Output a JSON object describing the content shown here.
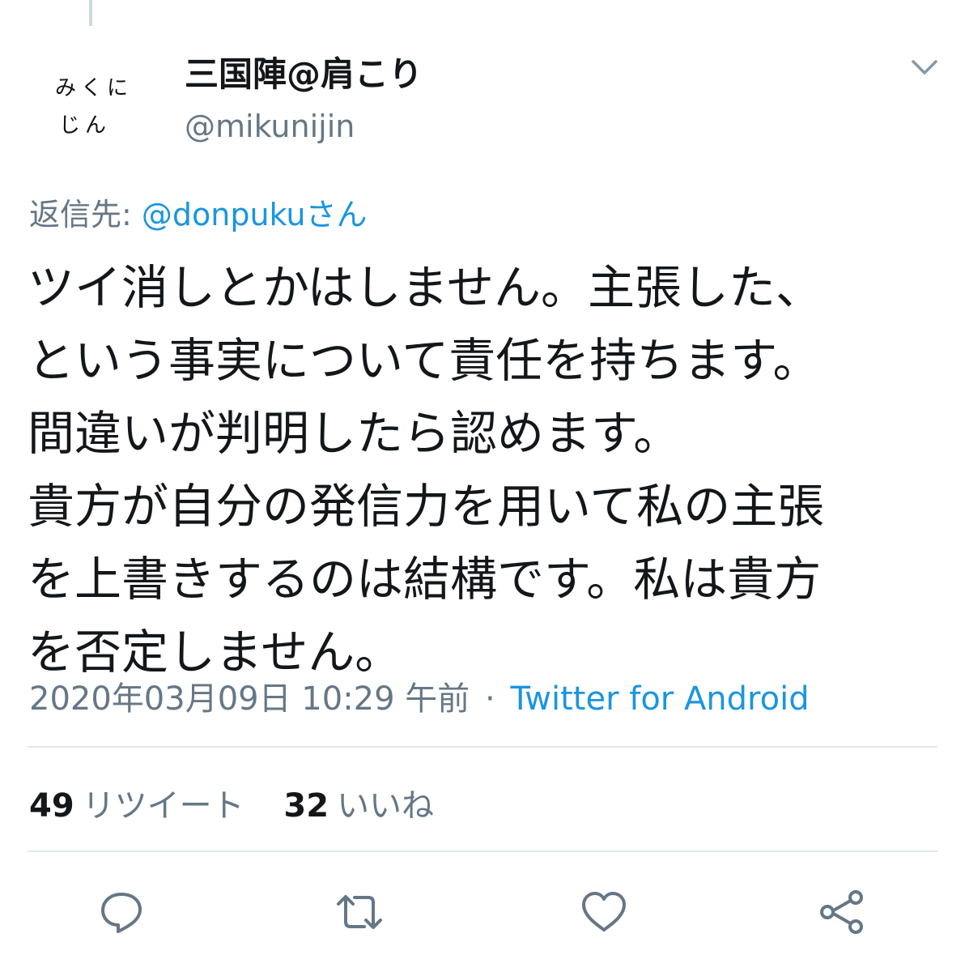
{
  "tweet": {
    "avatar_text": [
      "みくに",
      "じん"
    ],
    "display_name": "三国陣@肩こり",
    "handle": "@mikunijin",
    "reply_prefix": "返信先: ",
    "reply_to": "@donpukuさん",
    "body_lines": [
      "ツイ消しとかはしません。主張した、",
      "という事実について責任を持ちます。",
      "間違いが判明したら認めます。",
      "貴方が自分の発信力を用いて私の主張",
      "を上書きするのは結構です。私は貴方",
      "を否定しません。"
    ],
    "timestamp": "2020年03月09日 10:29 午前",
    "separator": "·",
    "source": "Twitter for Android"
  },
  "stats": {
    "retweets_count": "49",
    "retweets_label": "リツイート",
    "likes_count": "32",
    "likes_label": "いいね"
  },
  "icons": {
    "more": "chevron-down-icon",
    "reply": "reply-icon",
    "retweet": "retweet-icon",
    "like": "heart-icon",
    "share": "share-icon"
  },
  "colors": {
    "text_primary": "#14171a",
    "text_secondary": "#657786",
    "link": "#1b95e0",
    "divider": "#e1e8ed"
  }
}
